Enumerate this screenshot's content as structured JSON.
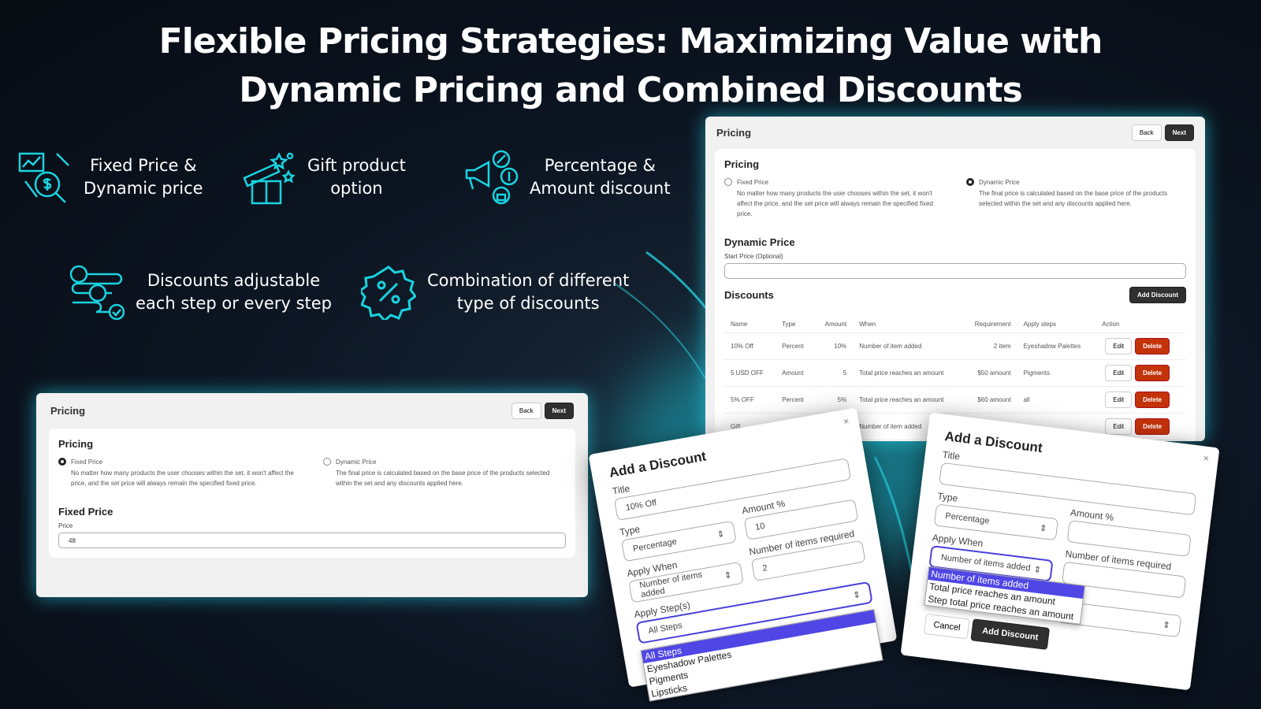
{
  "headline": {
    "line1": "Flexible Pricing Strategies: Maximizing Value with",
    "line2": "Dynamic Pricing and Combined Discounts"
  },
  "accent": "#19d3e0",
  "features": [
    {
      "icon": "chart-dollar-magnifier-icon",
      "line1": "Fixed Price &",
      "line2": "Dynamic price"
    },
    {
      "icon": "gift-box-icon",
      "line1": "Gift product",
      "line2": "option"
    },
    {
      "icon": "megaphone-percent-icon",
      "line1": "Percentage &",
      "line2": "Amount discount"
    },
    {
      "icon": "steps-flow-icon",
      "line1": "Discounts adjustable",
      "line2": "each step or every step"
    },
    {
      "icon": "percent-badge-icon",
      "line1": "Combination of different",
      "line2": "type of discounts"
    }
  ],
  "common": {
    "header": "Pricing",
    "back": "Back",
    "next": "Next",
    "section": "Pricing",
    "fixed_label": "Fixed Price",
    "fixed_desc": "No matter how many products the user chooses within the set, it won't affect the price, and the set price will always remain the specified fixed price.",
    "dynamic_label": "Dynamic Price",
    "dynamic_desc": "The final price is calculated based on the base price of the products selected within the set and any discounts applied here."
  },
  "fixed_panel": {
    "heading": "Fixed Price",
    "price_label": "Price",
    "price_value": "48"
  },
  "dynamic_panel": {
    "heading": "Dynamic Price",
    "start_label": "Start Price (Optional)",
    "start_value": "",
    "discounts_heading": "Discounts",
    "add_discount": "Add Discount",
    "columns": [
      "Name",
      "Type",
      "Amount",
      "When",
      "Requirement",
      "Apply steps",
      "Action"
    ],
    "rows": [
      {
        "name": "10% Off",
        "type": "Percent",
        "amount": "10%",
        "when": "Number of item added",
        "req": "2 item",
        "steps": "Eyeshadow Palettes"
      },
      {
        "name": "5 USD OFF",
        "type": "Amount",
        "amount": "5",
        "when": "Total price reaches an amount",
        "req": "$50 amount",
        "steps": "Pigments"
      },
      {
        "name": "5% OFF",
        "type": "Percent",
        "amount": "5%",
        "when": "Total price reaches an amount",
        "req": "$60 amount",
        "steps": "all"
      },
      {
        "name": "Gift",
        "type": "",
        "amount": "",
        "when": "Number of item added",
        "req": "",
        "steps": ""
      }
    ],
    "edit": "Edit",
    "delete": "Delete"
  },
  "modal_left": {
    "title": "Add a Discount",
    "close": "×",
    "title_label": "Title",
    "title_value": "10% Off",
    "type_label": "Type",
    "type_value": "Percentage",
    "amount_label": "Amount %",
    "amount_value": "10",
    "when_label": "Apply When",
    "when_value": "Number of items added",
    "req_label": "Number of items required",
    "req_value": "2",
    "steps_label": "Apply Step(s)",
    "steps_value": "All Steps",
    "options": [
      "All Steps",
      "Eyeshadow Palettes",
      "Pigments",
      "Lipsticks"
    ]
  },
  "modal_right": {
    "title": "Add a Discount",
    "close": "×",
    "title_label": "Title",
    "title_value": "",
    "type_label": "Type",
    "type_value": "Percentage",
    "amount_label": "Amount %",
    "amount_value": "",
    "when_label": "Apply When",
    "when_value": "Number of items added",
    "req_label": "Number of items required",
    "req_value": "",
    "options": [
      "Number of items added",
      "Total price reaches an amount",
      "Step total price reaches an amount"
    ],
    "cancel": "Cancel",
    "submit": "Add Discount"
  }
}
